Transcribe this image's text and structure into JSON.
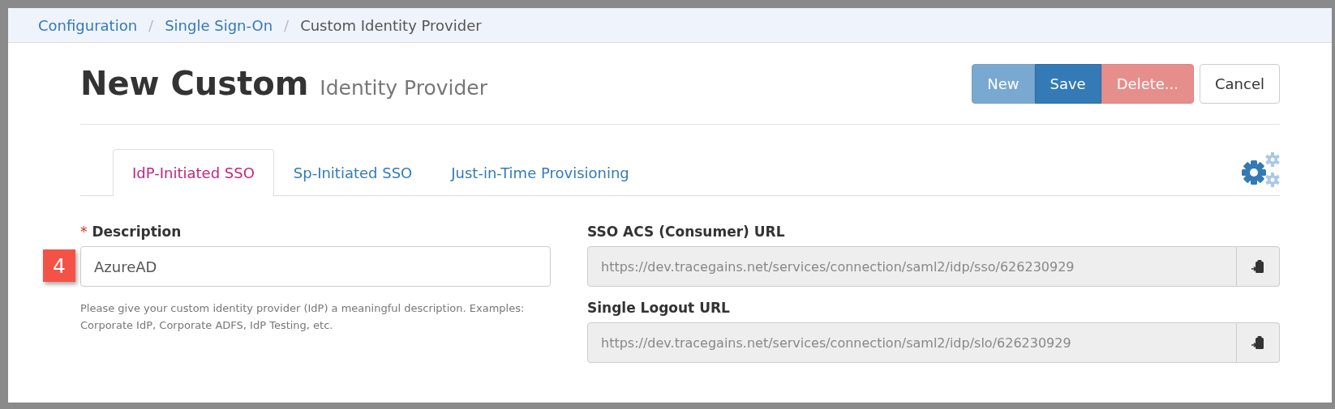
{
  "breadcrumb": [
    {
      "label": "Configuration",
      "link": true
    },
    {
      "label": "Single Sign-On",
      "link": true
    },
    {
      "label": "Custom Identity Provider",
      "link": false
    }
  ],
  "breadcrumb_separator": "/",
  "header": {
    "title": "New Custom",
    "subtitle": "Identity Provider"
  },
  "buttons": [
    {
      "label": "New",
      "kind": "primary",
      "disabled": true
    },
    {
      "label": "Save",
      "kind": "primary",
      "disabled": false
    },
    {
      "label": "Delete...",
      "kind": "danger",
      "disabled": true
    },
    {
      "label": "Cancel",
      "kind": "default",
      "disabled": false
    }
  ],
  "tabs": [
    {
      "label": "IdP-Initiated SSO",
      "selected": true
    },
    {
      "label": "Sp-Initiated SSO",
      "selected": false
    },
    {
      "label": "Just-in-Time Provisioning",
      "selected": false
    }
  ],
  "description": {
    "required_mark": "*",
    "label": "Description",
    "value": "AzureAD",
    "callout": "4",
    "help": "Please give your custom identity provider (IdP) a meaningful description. Examples: Corporate IdP, Corporate ADFS, IdP Testing, etc."
  },
  "url_fields": [
    {
      "label": "SSO ACS (Consumer) URL",
      "value": "https://dev.tracegains.net/services/connection/saml2/idp/sso/626230929"
    },
    {
      "label": "Single Logout URL",
      "value": "https://dev.tracegains.net/services/connection/saml2/idp/slo/626230929"
    }
  ]
}
